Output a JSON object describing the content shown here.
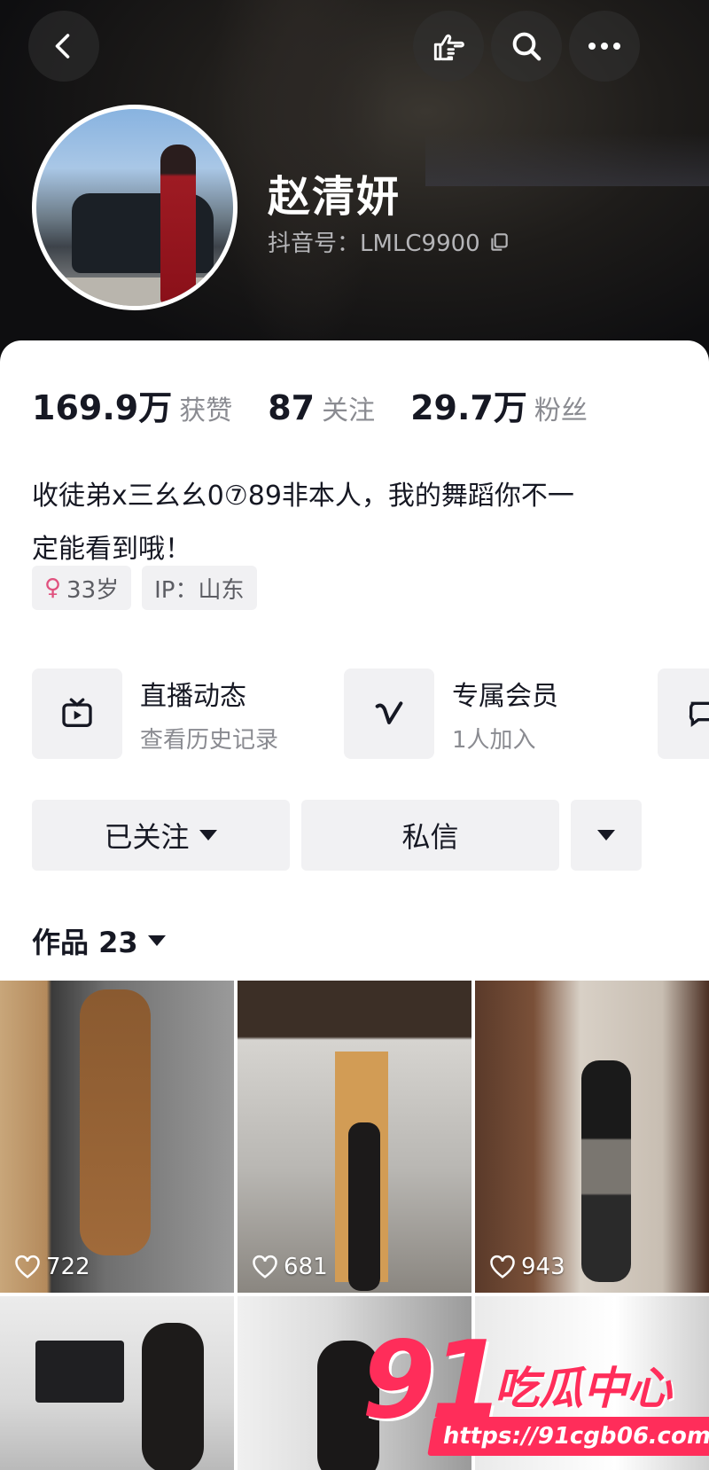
{
  "profile": {
    "name": "赵清妍",
    "douyin_id": "抖音号：LMLC9900"
  },
  "stats": [
    {
      "value": "169.9万",
      "label": "获赞"
    },
    {
      "value": "87",
      "label": "关注"
    },
    {
      "value": "29.7万",
      "label": "粉丝"
    }
  ],
  "bio": {
    "line1": "收徒弟x三幺幺0⑦89非本人，我的舞蹈你不一",
    "line2": "定能看到哦！"
  },
  "tags": {
    "gender_icon": "female-icon",
    "age": "33岁",
    "ip": "IP：山东"
  },
  "features": [
    {
      "title": "直播动态",
      "subtitle": "查看历史记录",
      "icon": "tv-icon"
    },
    {
      "title": "专属会员",
      "subtitle": "1人加入",
      "icon": "v-icon"
    }
  ],
  "actions": {
    "follow": "已关注",
    "message": "私信"
  },
  "works": {
    "label": "作品 23"
  },
  "videos": [
    {
      "likes": "722"
    },
    {
      "likes": "681"
    },
    {
      "likes": "943"
    }
  ],
  "watermark": {
    "number": "91",
    "text": "吃瓜中心",
    "url": "https://91cgb06.com"
  },
  "colors": {
    "accent": "#ff2d5a",
    "chip_bg": "#f1f1f3",
    "secondary_text": "#8a8b91"
  }
}
